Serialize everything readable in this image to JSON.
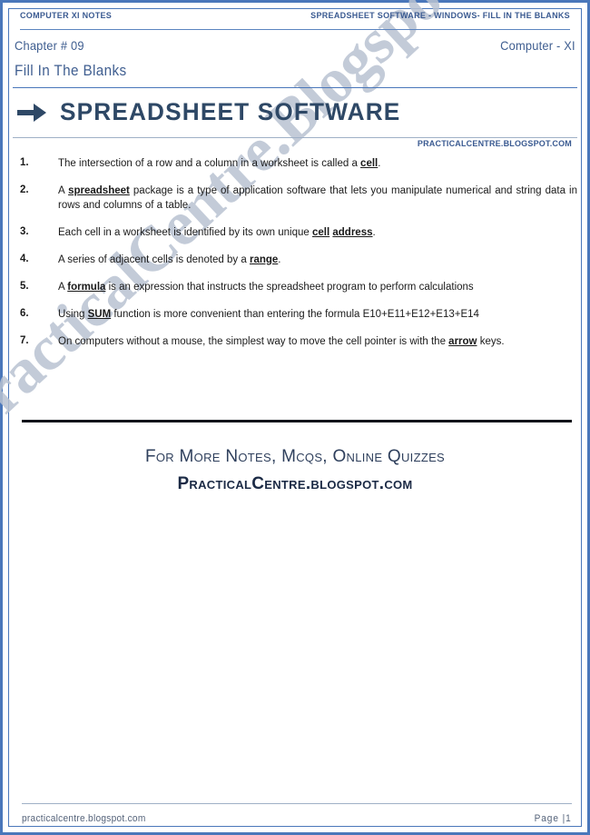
{
  "header": {
    "left": "Computer XI Notes",
    "right": "Spreadsheet Software - Windows- Fill In The Blanks"
  },
  "chapter": {
    "label": "Chapter # 09",
    "right": "Computer - XI",
    "subtitle": "Fill In The Blanks"
  },
  "title": {
    "arrow_icon": "right-arrow-icon",
    "text": "SPREADSHEET SOFTWARE",
    "brand_small": "PracticalCentre.Blogspot.com"
  },
  "questions": [
    {
      "num": "1.",
      "parts": [
        {
          "t": "The intersection of a row and a column in a worksheet is called a ",
          "b": false
        },
        {
          "t": "cell",
          "b": true
        },
        {
          "t": ".",
          "b": false
        }
      ]
    },
    {
      "num": "2.",
      "justify": true,
      "parts": [
        {
          "t": "A ",
          "b": false
        },
        {
          "t": "spreadsheet",
          "b": true
        },
        {
          "t": " package is a type of application software that lets you manipulate numerical and string data in rows and columns of a table.",
          "b": false
        }
      ]
    },
    {
      "num": "3.",
      "parts": [
        {
          "t": "Each cell in a worksheet is identified by its own unique ",
          "b": false
        },
        {
          "t": "cell",
          "b": true
        },
        {
          "t": " ",
          "b": false
        },
        {
          "t": "address",
          "b": true
        },
        {
          "t": ".",
          "b": false
        }
      ]
    },
    {
      "num": "4.",
      "parts": [
        {
          "t": "A series of adjacent cells is denoted by a ",
          "b": false
        },
        {
          "t": "range",
          "b": true
        },
        {
          "t": ".",
          "b": false
        }
      ]
    },
    {
      "num": "5.",
      "parts": [
        {
          "t": "A ",
          "b": false
        },
        {
          "t": "formula",
          "b": true
        },
        {
          "t": " is an expression that instructs the spreadsheet program to perform calculations",
          "b": false
        }
      ]
    },
    {
      "num": "6.",
      "parts": [
        {
          "t": "Using ",
          "b": false
        },
        {
          "t": "SUM",
          "b": true
        },
        {
          "t": " function is more convenient than entering the formula E10+E11+E12+E13+E14",
          "b": false
        }
      ]
    },
    {
      "num": "7.",
      "justify": true,
      "parts": [
        {
          "t": "On computers without a mouse, the simplest way to move the cell pointer is with the ",
          "b": false
        },
        {
          "t": "arrow",
          "b": true
        },
        {
          "t": " keys.",
          "b": false
        }
      ]
    }
  ],
  "promo": {
    "line1": "For More Notes, Mcqs, Online Quizzes",
    "line2": "PracticalCentre.blogspot.com"
  },
  "watermark": {
    "text": "PracticalCentre.Blogspot.com"
  },
  "footer": {
    "left": "practicalcentre.blogspot.com",
    "right": "Page |1"
  },
  "colors": {
    "border_blue": "#4a77ba",
    "header_blue": "#3a5a91",
    "title_navy": "#2e4866",
    "rule_dark": "#12131a",
    "watermark_grey": "#b9c3d2"
  }
}
